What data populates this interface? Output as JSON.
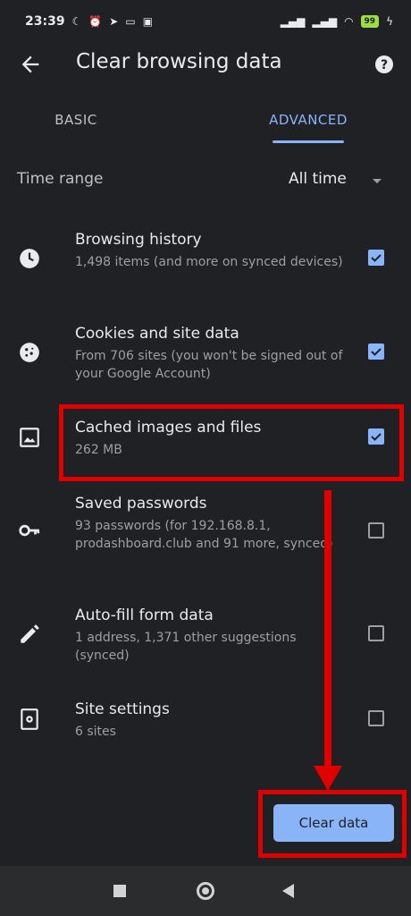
{
  "status_bar": {
    "time": "23:39",
    "battery": "99"
  },
  "header": {
    "title": "Clear browsing data"
  },
  "tabs": [
    {
      "label": "BASIC",
      "selected": false
    },
    {
      "label": "ADVANCED",
      "selected": true
    }
  ],
  "time_range": {
    "label": "Time range",
    "value": "All time"
  },
  "items": [
    {
      "title": "Browsing history",
      "description": "1,498 items (and more on synced devices)",
      "checked": true,
      "icon": "clock-icon"
    },
    {
      "title": "Cookies and site data",
      "description": "From 706 sites (you won't be signed out of your Google Account)",
      "checked": true,
      "icon": "cookie-icon"
    },
    {
      "title": "Cached images and files",
      "description": "262 MB",
      "checked": true,
      "icon": "image-icon"
    },
    {
      "title": "Saved passwords",
      "description": "93 passwords (for 192.168.8.1, prodashboard.club and 91 more, synced)",
      "checked": false,
      "icon": "key-icon"
    },
    {
      "title": "Auto-fill form data",
      "description": "1 address, 1,371 other suggestions (synced)",
      "checked": false,
      "icon": "pencil-icon"
    },
    {
      "title": "Site settings",
      "description": "6 sites",
      "checked": false,
      "icon": "site-settings-icon"
    }
  ],
  "actions": {
    "clear_label": "Clear data"
  },
  "colors": {
    "background": "#202124",
    "accent": "#8ab4f8",
    "annotation": "#e00000"
  }
}
